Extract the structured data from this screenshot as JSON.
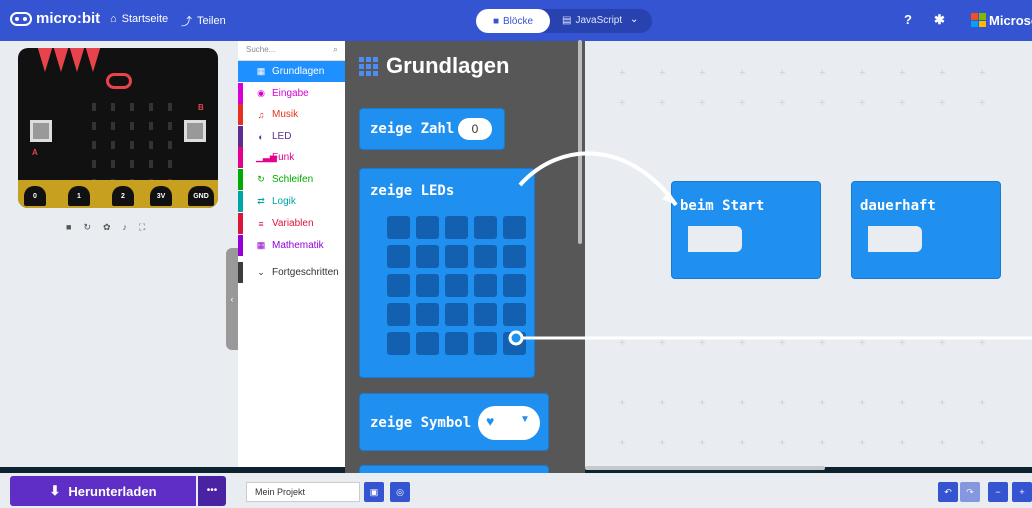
{
  "header": {
    "logo_text": "micro:bit",
    "nav_home": "Startseite",
    "nav_share": "Teilen",
    "mode_blocks": "Blöcke",
    "mode_js": "JavaScript",
    "brand": "Microsof"
  },
  "simulator": {
    "pin_labels": [
      "0",
      "1",
      "2",
      "3V",
      "GND"
    ],
    "marker_a": "A",
    "marker_b": "B"
  },
  "categories": {
    "search_placeholder": "Suche...",
    "items": [
      {
        "label": "Grundlagen",
        "color": "#1e90ff"
      },
      {
        "label": "Eingabe",
        "color": "#d400d4"
      },
      {
        "label": "Musik",
        "color": "#e63022"
      },
      {
        "label": "LED",
        "color": "#5c2d91"
      },
      {
        "label": "Funk",
        "color": "#e3008c"
      },
      {
        "label": "Schleifen",
        "color": "#00aa00"
      },
      {
        "label": "Logik",
        "color": "#00a4a6"
      },
      {
        "label": "Variablen",
        "color": "#dc143c"
      },
      {
        "label": "Mathematik",
        "color": "#9400d3"
      },
      {
        "label": "Fortgeschritten",
        "color": "#3c3c3c"
      }
    ]
  },
  "flyout": {
    "title": "Grundlagen",
    "block_show_number": "zeige Zahl",
    "number_value": "0",
    "block_show_leds": "zeige LEDs",
    "block_show_icon": "zeige Symbol"
  },
  "workspace": {
    "on_start": "beim Start",
    "forever": "dauerhaft"
  },
  "footer": {
    "download_label": "Herunterladen",
    "more_label": "•••",
    "project_name": "Mein Projekt"
  }
}
